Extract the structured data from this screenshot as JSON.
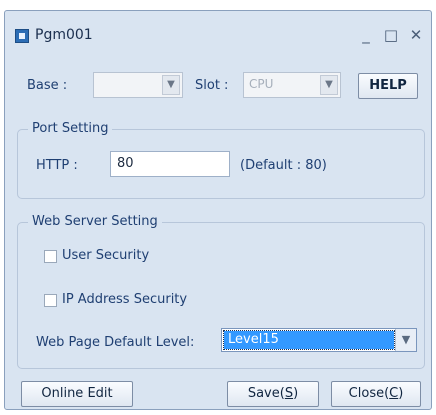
{
  "window": {
    "title": "Pgm001",
    "minimize_glyph": "_",
    "maximize_glyph": "□",
    "close_glyph": "✕"
  },
  "top_row": {
    "base_label": "Base :",
    "base_value": "",
    "slot_label": "Slot :",
    "slot_value": "CPU",
    "help_label": "HELP"
  },
  "port_setting": {
    "title": "Port Setting",
    "http_label": "HTTP :",
    "http_value": "80",
    "default_text": "(Default : 80)"
  },
  "web_server_setting": {
    "title": "Web Server Setting",
    "user_security_label": "User Security",
    "user_security_checked": false,
    "ip_security_label": "IP Address Security",
    "ip_security_checked": false,
    "default_level_label": "Web Page Default Level:",
    "default_level_value": "Level15"
  },
  "bottom_buttons": {
    "online_edit": "Online Edit",
    "save_text": "Save(",
    "save_mnemonic": "S",
    "save_close": ")",
    "close_text": "Close(",
    "close_mnemonic": "C",
    "close_close": ")"
  },
  "icons": {
    "dropdown": "▼",
    "app": "app-icon"
  }
}
